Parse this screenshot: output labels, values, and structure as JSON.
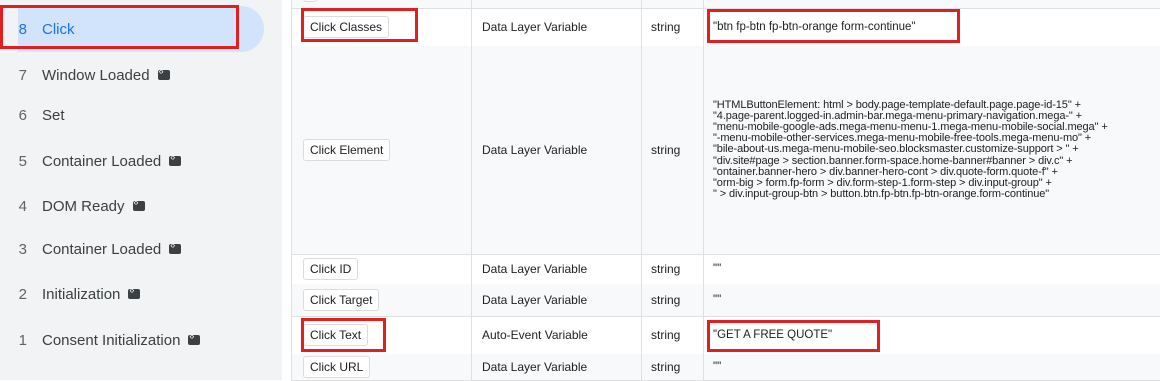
{
  "sidebar": {
    "items": [
      {
        "num": "8",
        "label": "Click",
        "active": true,
        "tag": false
      },
      {
        "num": "7",
        "label": "Window Loaded",
        "tag": true
      },
      {
        "num": "6",
        "label": "Set",
        "tag": false
      },
      {
        "num": "5",
        "label": "Container Loaded",
        "tag": true
      },
      {
        "num": "4",
        "label": "DOM Ready",
        "tag": true
      },
      {
        "num": "3",
        "label": "Container Loaded",
        "tag": true
      },
      {
        "num": "2",
        "label": "Initialization",
        "tag": true
      },
      {
        "num": "1",
        "label": "Consent Initialization",
        "tag": true
      }
    ]
  },
  "variables": [
    {
      "name": "Click Classes",
      "type": "Data Layer Variable",
      "kind": "string",
      "value": "\"btn fp-btn fp-btn-orange form-continue\""
    },
    {
      "name": "Click Element",
      "type": "Data Layer Variable",
      "kind": "string",
      "value": "\"HTMLButtonElement: html > body.page-template-default.page.page-id-15\" +\n\"4.page-parent.logged-in.admin-bar.mega-menu-primary-navigation.mega-\" +\n\"menu-mobile-google-ads.mega-menu-menu-1.mega-menu-mobile-social.mega\" +\n\"-menu-mobile-other-services.mega-menu-mobile-free-tools.mega-menu-mo\" +\n\"bile-about-us.mega-menu-mobile-seo.blocksmaster.customize-support > \" +\n\"div.site#page > section.banner.form-space.home-banner#banner > div.c\" +\n\"ontainer.banner-hero > div.banner-hero-cont > div.quote-form.quote-f\" +\n\"orm-big > form.fp-form > div.form-step-1.form-step > div.input-group\" +\n\" > div.input-group-btn > button.btn.fp-btn.fp-btn-orange.form-continue\""
    },
    {
      "name": "Click ID",
      "type": "Data Layer Variable",
      "kind": "string",
      "value": "\"\""
    },
    {
      "name": "Click Target",
      "type": "Data Layer Variable",
      "kind": "string",
      "value": "\"\""
    },
    {
      "name": "Click Text",
      "type": "Auto-Event Variable",
      "kind": "string",
      "value": "\"GET A FREE QUOTE\""
    },
    {
      "name": "Click URL",
      "type": "Data Layer Variable",
      "kind": "string",
      "value": "\"\""
    }
  ]
}
